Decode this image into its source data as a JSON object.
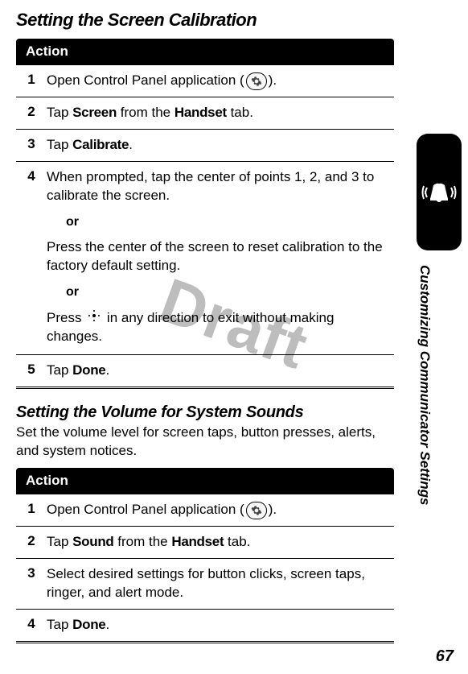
{
  "watermark": "Draft",
  "page_number": "67",
  "side_label": "Customizing Communicator Settings",
  "section1": {
    "title": "Setting the Screen Calibration",
    "action_label": "Action",
    "steps": [
      {
        "num": "1",
        "pre": "Open Control Panel application (",
        "post": ")."
      },
      {
        "num": "2",
        "pre": "Tap ",
        "b1": "Screen",
        "mid": " from the ",
        "b2": "Handset",
        "post": " tab."
      },
      {
        "num": "3",
        "pre": "Tap ",
        "b1": "Calibrate",
        "post": "."
      },
      {
        "num": "4",
        "line1": "When prompted, tap the center of points 1, 2, and 3 to calibrate the screen.",
        "or": "or",
        "line2": "Press the center of the screen to reset calibration to the factory default setting.",
        "line3a": "Press ",
        "line3b": " in any direction to exit without making changes."
      },
      {
        "num": "5",
        "pre": "Tap ",
        "b1": "Done",
        "post": "."
      }
    ]
  },
  "section2": {
    "title": "Setting the Volume for System Sounds",
    "intro": "Set the volume level for screen taps, button presses, alerts, and system notices.",
    "action_label": "Action",
    "steps": [
      {
        "num": "1",
        "pre": "Open Control Panel application (",
        "post": ")."
      },
      {
        "num": "2",
        "pre": "Tap ",
        "b1": "Sound",
        "mid": " from the ",
        "b2": "Handset",
        "post": " tab."
      },
      {
        "num": "3",
        "text": "Select desired settings for button clicks, screen taps, ringer, and alert mode."
      },
      {
        "num": "4",
        "pre": "Tap ",
        "b1": "Done",
        "post": "."
      }
    ]
  }
}
